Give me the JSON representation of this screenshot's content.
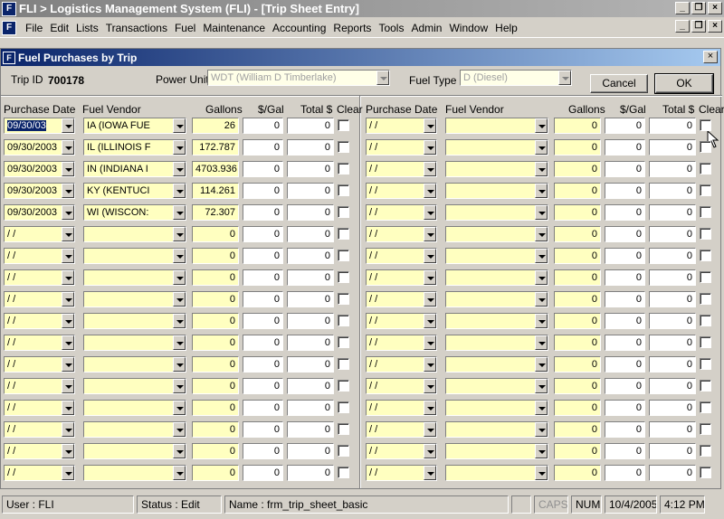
{
  "app": {
    "title": "FLI > Logistics Management System (FLI) - [Trip Sheet Entry]",
    "icon": "fli-logo-icon"
  },
  "menu": [
    "File",
    "Edit",
    "Lists",
    "Transactions",
    "Fuel",
    "Maintenance",
    "Accounting",
    "Reports",
    "Tools",
    "Admin",
    "Window",
    "Help"
  ],
  "dialog": {
    "title": "Fuel Purchases by Trip",
    "trip_id_label": "Trip ID",
    "trip_id": "700178",
    "power_unit_label": "Power Unit",
    "power_unit": "WDT      (William D Timberlake)",
    "fuel_type_label": "Fuel Type",
    "fuel_type": "D          (Diesel)",
    "cancel": "Cancel",
    "ok": "OK",
    "columns": {
      "date": "Purchase Date",
      "vendor": "Fuel Vendor",
      "gallons": "Gallons",
      "pergal": "$/Gal",
      "total": "Total $",
      "clear": "Clear"
    },
    "left_rows": [
      {
        "date": "09/30/03",
        "vendor": "IA        (IOWA FUE",
        "gallons": "26",
        "pergal": "0",
        "total": "0"
      },
      {
        "date": "09/30/2003",
        "vendor": "IL        (ILLINOIS F",
        "gallons": "172.787",
        "pergal": "0",
        "total": "0"
      },
      {
        "date": "09/30/2003",
        "vendor": "IN        (INDIANA I",
        "gallons": "4703.936",
        "pergal": "0",
        "total": "0"
      },
      {
        "date": "09/30/2003",
        "vendor": "KY        (KENTUCI",
        "gallons": "114.261",
        "pergal": "0",
        "total": "0"
      },
      {
        "date": "09/30/2003",
        "vendor": "WI        (WISCON:",
        "gallons": "72.307",
        "pergal": "0",
        "total": "0"
      },
      {
        "date": " /  /",
        "vendor": "",
        "gallons": "0",
        "pergal": "0",
        "total": "0"
      },
      {
        "date": " /  /",
        "vendor": "",
        "gallons": "0",
        "pergal": "0",
        "total": "0"
      },
      {
        "date": " /  /",
        "vendor": "",
        "gallons": "0",
        "pergal": "0",
        "total": "0"
      },
      {
        "date": " /  /",
        "vendor": "",
        "gallons": "0",
        "pergal": "0",
        "total": "0"
      },
      {
        "date": " /  /",
        "vendor": "",
        "gallons": "0",
        "pergal": "0",
        "total": "0"
      },
      {
        "date": " /  /",
        "vendor": "",
        "gallons": "0",
        "pergal": "0",
        "total": "0"
      },
      {
        "date": " /  /",
        "vendor": "",
        "gallons": "0",
        "pergal": "0",
        "total": "0"
      },
      {
        "date": " /  /",
        "vendor": "",
        "gallons": "0",
        "pergal": "0",
        "total": "0"
      },
      {
        "date": " /  /",
        "vendor": "",
        "gallons": "0",
        "pergal": "0",
        "total": "0"
      },
      {
        "date": " /  /",
        "vendor": "",
        "gallons": "0",
        "pergal": "0",
        "total": "0"
      },
      {
        "date": " /  /",
        "vendor": "",
        "gallons": "0",
        "pergal": "0",
        "total": "0"
      },
      {
        "date": " /  /",
        "vendor": "",
        "gallons": "0",
        "pergal": "0",
        "total": "0"
      }
    ],
    "right_rows_count": 17,
    "right_empty_row": {
      "date": " /  /",
      "vendor": "",
      "gallons": "0",
      "pergal": "0",
      "total": "0"
    }
  },
  "status": {
    "user": "User : FLI",
    "mode": "Status : Edit",
    "name": "Name : frm_trip_sheet_basic",
    "caps": "CAPS",
    "num": "NUM",
    "date": "10/4/2005",
    "time": "4:12 PM"
  }
}
